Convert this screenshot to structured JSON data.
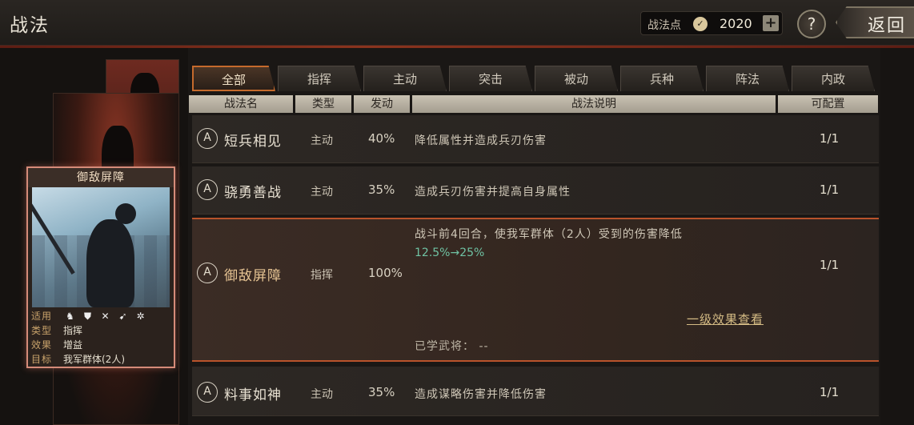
{
  "header": {
    "title": "战法",
    "points_label": "战法点",
    "points_icon": "✓",
    "points_value": "2020",
    "plus_label": "+",
    "help_label": "?",
    "back_label": "返回"
  },
  "card": {
    "name": "御敌屏障",
    "suit_label": "适用",
    "suit_icons": [
      "cavalry-icon",
      "shield-icon",
      "bow-icon",
      "spear-icon",
      "wheel-icon"
    ],
    "suit_glyphs": [
      "♞",
      "⛊",
      "✕",
      "➹",
      "✲"
    ],
    "info": [
      {
        "key": "类型",
        "value": "指挥"
      },
      {
        "key": "效果",
        "value": "增益"
      },
      {
        "key": "目标",
        "value": "我军群体(2人)"
      }
    ]
  },
  "tabs": [
    "全部",
    "指挥",
    "主动",
    "突击",
    "被动",
    "兵种",
    "阵法",
    "内政"
  ],
  "active_tab": 0,
  "columns": [
    "战法名",
    "类型",
    "发动",
    "战法说明",
    "可配置"
  ],
  "skills": [
    {
      "badge": "A",
      "name": "短兵相见",
      "type": "主动",
      "rate": "40%",
      "desc": "降低属性并造成兵刃伤害",
      "slots": "1/1"
    },
    {
      "badge": "A",
      "name": "骁勇善战",
      "type": "主动",
      "rate": "35%",
      "desc": "造成兵刃伤害并提高自身属性",
      "slots": "1/1"
    },
    {
      "badge": "A",
      "name": "御敌屏障",
      "type": "指挥",
      "rate": "100%",
      "desc": "战斗前4回合，使我军群体（2人）受到的伤害降低",
      "desc2": "12.5%→25%",
      "slots": "1/1",
      "link": "一级效果查看",
      "learned": "已学武将：  --"
    },
    {
      "badge": "A",
      "name": "料事如神",
      "type": "主动",
      "rate": "35%",
      "desc": "造成谋略伤害并降低伤害",
      "slots": "1/1"
    }
  ]
}
